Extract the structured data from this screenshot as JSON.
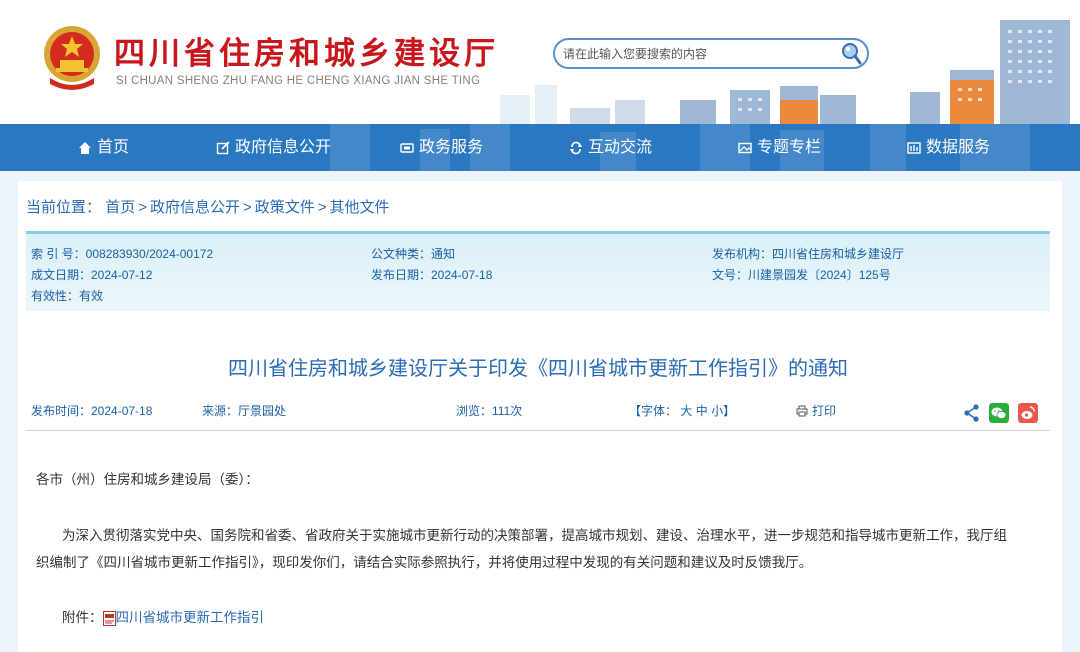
{
  "header": {
    "title": "四川省住房和城乡建设厅",
    "subtitle": "SI CHUAN SHENG ZHU FANG HE CHENG XIANG JIAN SHE TING",
    "search_placeholder": "请在此输入您要搜索的内容"
  },
  "nav": {
    "items": [
      {
        "label": "首页",
        "icon": "home-icon"
      },
      {
        "label": "政府信息公开",
        "icon": "edit-icon"
      },
      {
        "label": "政务服务",
        "icon": "service-icon"
      },
      {
        "label": "互动交流",
        "icon": "exchange-icon"
      },
      {
        "label": "专题专栏",
        "icon": "image-icon"
      },
      {
        "label": "数据服务",
        "icon": "data-icon"
      }
    ]
  },
  "breadcrumb": {
    "prefix": "当前位置：",
    "items": [
      "首页",
      "政府信息公开",
      "政策文件",
      "其他文件"
    ]
  },
  "meta": {
    "index_no": "索 引 号：008283930/2024-00172",
    "doc_type": "公文种类：通知",
    "issuer": "发布机构：四川省住房和城乡建设厅",
    "created_date": "成文日期：2024-07-12",
    "publish_date": "发布日期：2024-07-18",
    "doc_no": "文号：川建景园发〔2024〕125号",
    "validity": "有效性：有效"
  },
  "article": {
    "title": "四川省住房和城乡建设厅关于印发《四川省城市更新工作指引》的通知",
    "publish_time": "发布时间：2024-07-18",
    "source": "来源：厅景园处",
    "views": "浏览：111次",
    "font_label": "【字体：",
    "font_large": "大",
    "font_medium": "中",
    "font_small": "小",
    "font_close": "】",
    "print_label": "打印",
    "salutation": "各市（州）住房和城乡建设局（委）：",
    "paragraph_line1": "为深入贯彻落实党中央、国务院和省委、省政府关于实施城市更新行动的决策部署，提高城市规划、建设、治理水平，进一步规范和指导城市更新工作，我厅组",
    "paragraph_line2": "织编制了《四川省城市更新工作指引》，现印发你们，请结合实际参照执行，并将使用过程中发现的有关问题和建议及时反馈我厅。",
    "attachment_label": "附件：",
    "attachment_link": "四川省城市更新工作指引"
  },
  "colors": {
    "brand_red": "#c8161d",
    "nav_blue": "#2a78c2",
    "link_blue": "#2b6cb6",
    "wechat_green": "#2aae3a",
    "weibo_red": "#e8584d"
  }
}
